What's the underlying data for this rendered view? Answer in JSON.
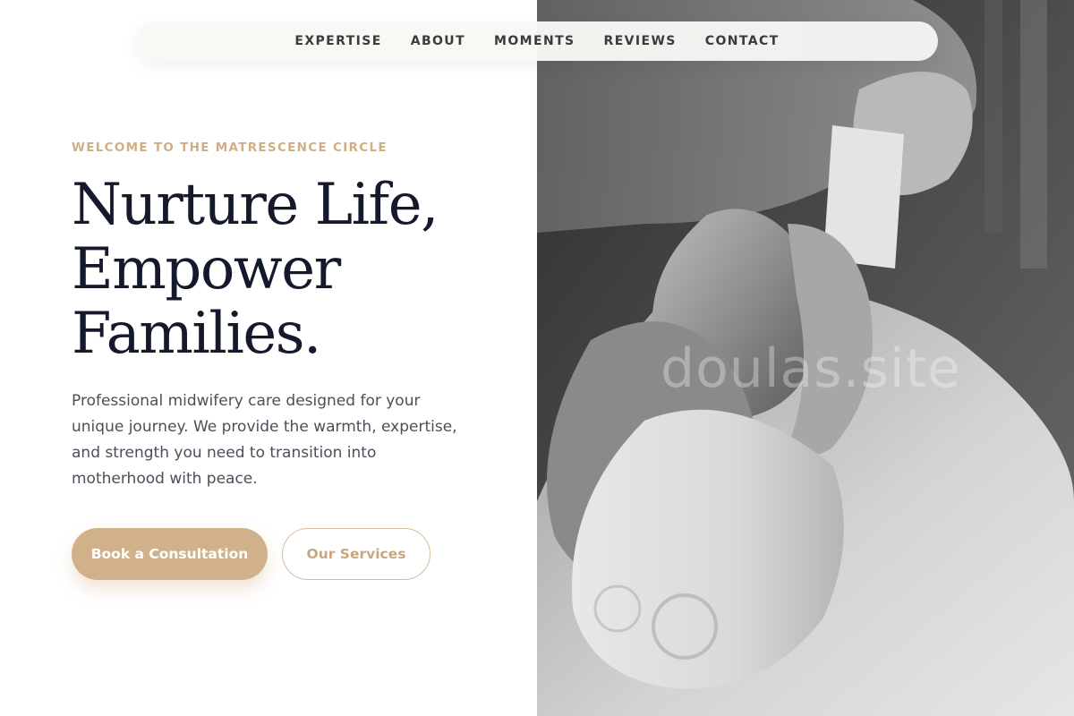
{
  "nav": {
    "items": [
      {
        "label": "EXPERTISE"
      },
      {
        "label": "ABOUT"
      },
      {
        "label": "MOMENTS"
      },
      {
        "label": "REVIEWS"
      },
      {
        "label": "CONTACT"
      }
    ]
  },
  "hero": {
    "eyebrow": "WELCOME TO THE MATRESCENCE CIRCLE",
    "headline_lines": [
      "Nurture Life,",
      "Empower",
      "Families."
    ],
    "lede_lines": [
      "Professional midwifery care designed for your",
      "unique journey. We provide the warmth, expertise,",
      "and strength you need to transition into",
      "motherhood with peace."
    ],
    "primary_cta": "Book a Consultation",
    "secondary_cta": "Our Services"
  },
  "photo": {
    "watermark": "doulas.site",
    "style": "black-and-white",
    "subject": "baby-in-diaper-icon"
  },
  "colors": {
    "accent": "#d1b189",
    "headline": "#141a2b",
    "body_text": "#4a4f59",
    "nav_text": "#3b3b3f"
  }
}
